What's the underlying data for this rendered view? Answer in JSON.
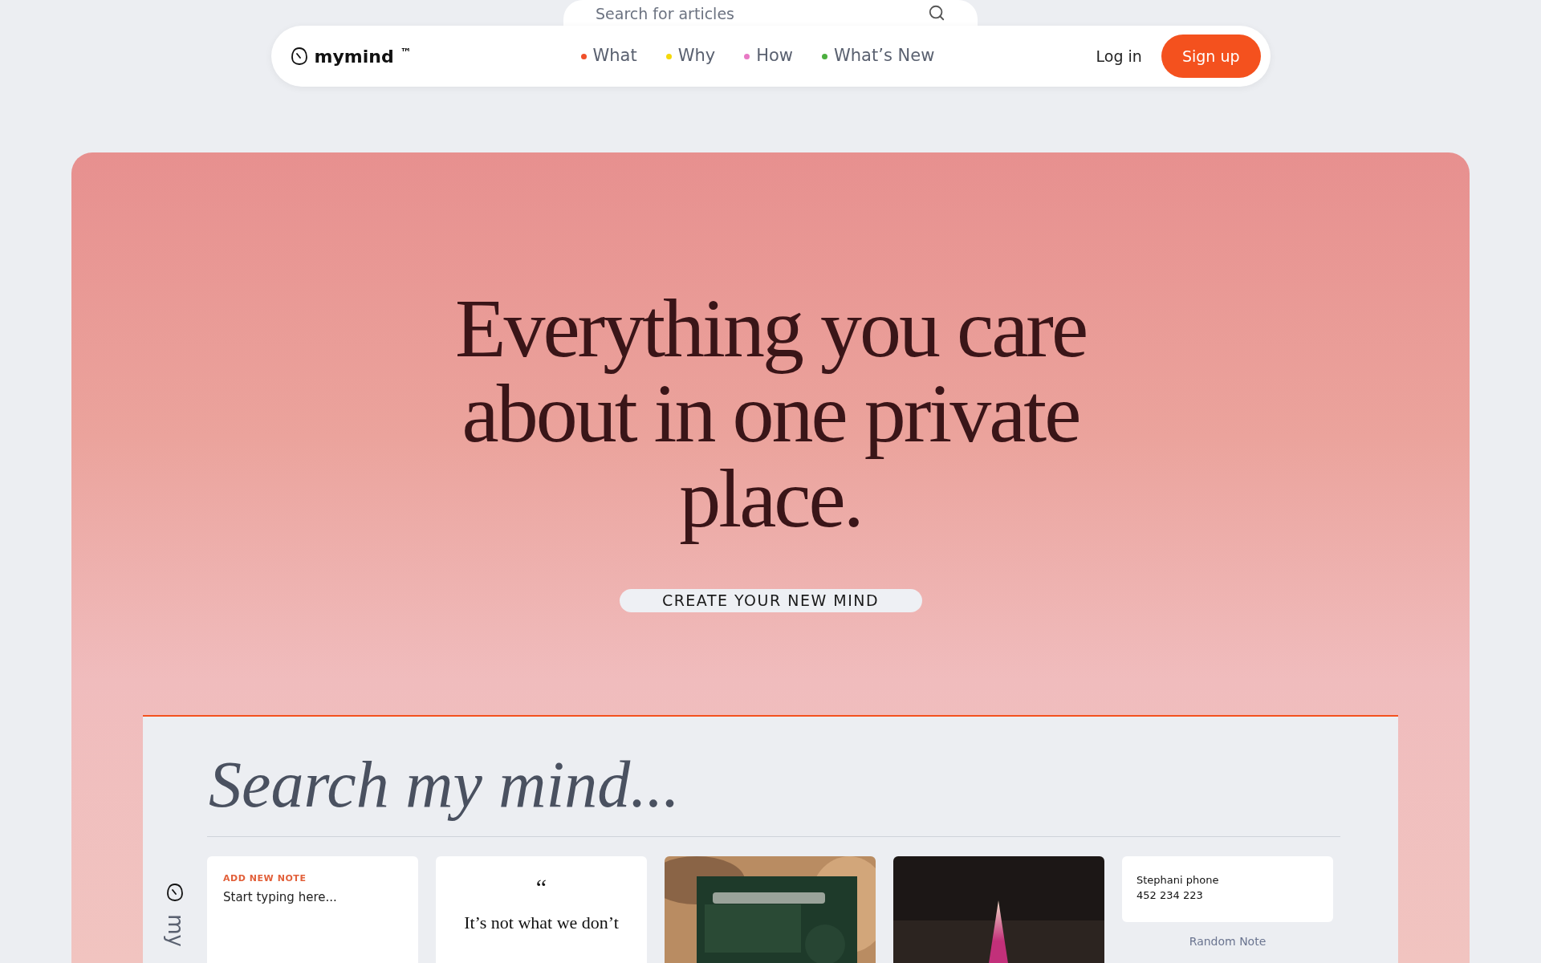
{
  "search": {
    "placeholder": "Search for articles"
  },
  "nav": {
    "logo": "mymind",
    "trademark": "™",
    "links": [
      {
        "label": "What",
        "color": "#f0502a"
      },
      {
        "label": "Why",
        "color": "#f5d90a"
      },
      {
        "label": "How",
        "color": "#e879c4"
      },
      {
        "label": "What’s New",
        "color": "#4caf3f"
      }
    ],
    "login": "Log in",
    "signup": "Sign up"
  },
  "hero": {
    "headline": "Everything you care about in one private place.",
    "cta": "CREATE YOUR NEW MIND"
  },
  "app": {
    "search_prompt": "Search my mind...",
    "side_label": "my",
    "cards": [
      {
        "kind": "note",
        "label": "ADD NEW NOTE",
        "text": "Start typing here..."
      },
      {
        "kind": "quote",
        "mark": "“",
        "text": "It’s not what we don’t"
      },
      {
        "kind": "picture"
      },
      {
        "kind": "picture"
      },
      {
        "kind": "contact",
        "lines": [
          "Stephani phone",
          "452 234 223"
        ],
        "caption": "Random Note"
      }
    ]
  }
}
